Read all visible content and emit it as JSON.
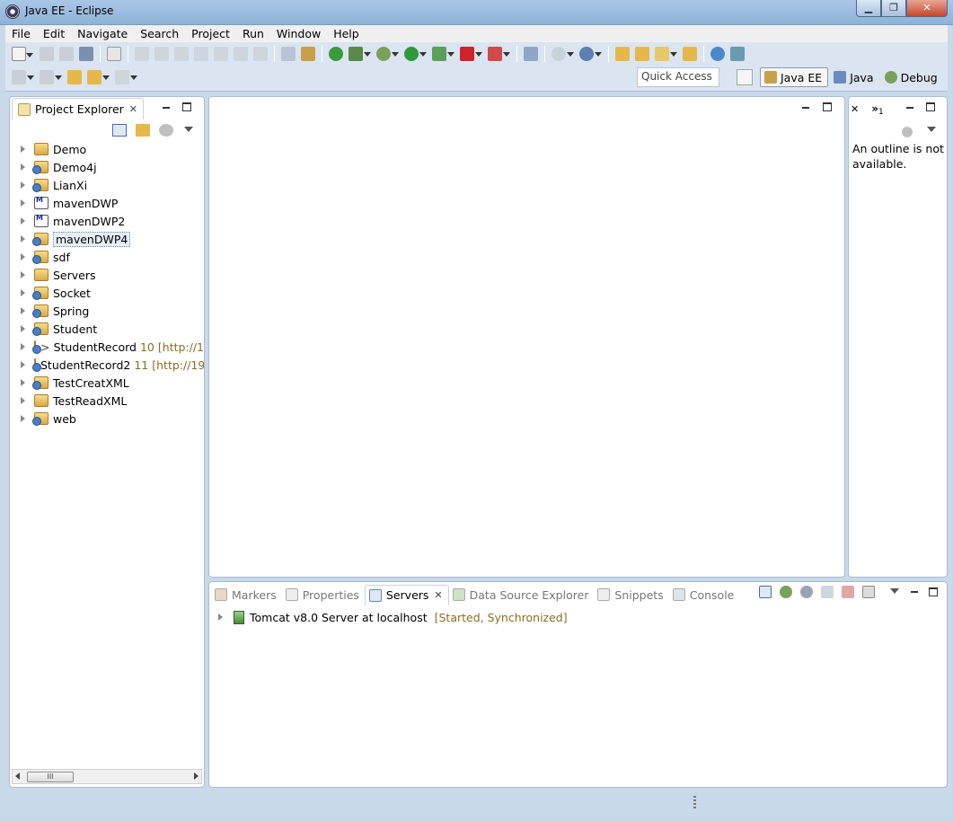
{
  "window": {
    "title": "Java EE - Eclipse"
  },
  "menu": [
    "File",
    "Edit",
    "Navigate",
    "Search",
    "Project",
    "Run",
    "Window",
    "Help"
  ],
  "toolbar": {
    "quick_access_placeholder": "Quick Access",
    "perspectives": [
      {
        "label": "Java EE",
        "active": true
      },
      {
        "label": "Java",
        "active": false
      },
      {
        "label": "Debug",
        "active": false
      }
    ]
  },
  "project_explorer": {
    "title": "Project Explorer",
    "items": [
      {
        "label": "Demo",
        "icon": "folder-icon"
      },
      {
        "label": "Demo4j",
        "icon": "web-project-icon"
      },
      {
        "label": "LianXi",
        "icon": "web-project-icon"
      },
      {
        "label": "mavenDWP",
        "icon": "maven-project-icon"
      },
      {
        "label": "mavenDWP2",
        "icon": "maven-project-icon"
      },
      {
        "label": "mavenDWP4",
        "icon": "maven-web-project-icon",
        "selected": true
      },
      {
        "label": "sdf",
        "icon": "maven-web-project-icon"
      },
      {
        "label": "Servers",
        "icon": "folder-icon"
      },
      {
        "label": "Socket",
        "icon": "web-project-icon"
      },
      {
        "label": "Spring",
        "icon": "web-project-icon"
      },
      {
        "label": "Student",
        "icon": "web-project-icon"
      },
      {
        "label": "StudentRecord",
        "icon": "svn-web-project-icon",
        "dirty": ">",
        "extra": "10 [http://1"
      },
      {
        "label": "StudentRecord2",
        "icon": "svn-web-project-icon",
        "extra": "11 [http://19"
      },
      {
        "label": "TestCreatXML",
        "icon": "web-project-icon"
      },
      {
        "label": "TestReadXML",
        "icon": "folder-icon"
      },
      {
        "label": "web",
        "icon": "maven-web-project-icon"
      }
    ],
    "scroll_thumb_glyph": "III"
  },
  "outline": {
    "tab_overflow": "»",
    "tab_overflow_count": "1",
    "message": "An outline is not available."
  },
  "bottom_panel": {
    "tabs": [
      {
        "label": "Markers",
        "active": false
      },
      {
        "label": "Properties",
        "active": false
      },
      {
        "label": "Servers",
        "active": true
      },
      {
        "label": "Data Source Explorer",
        "active": false
      },
      {
        "label": "Snippets",
        "active": false
      },
      {
        "label": "Console",
        "active": false
      }
    ],
    "server": {
      "name": "Tomcat v8.0 Server at localhost",
      "status": "[Started, Synchronized]"
    }
  },
  "colors": {
    "accent": "#8fb2d8",
    "decorator_text": "#8a6d1f",
    "run_green": "#2e9a3a",
    "stop_red": "#d0222a"
  }
}
